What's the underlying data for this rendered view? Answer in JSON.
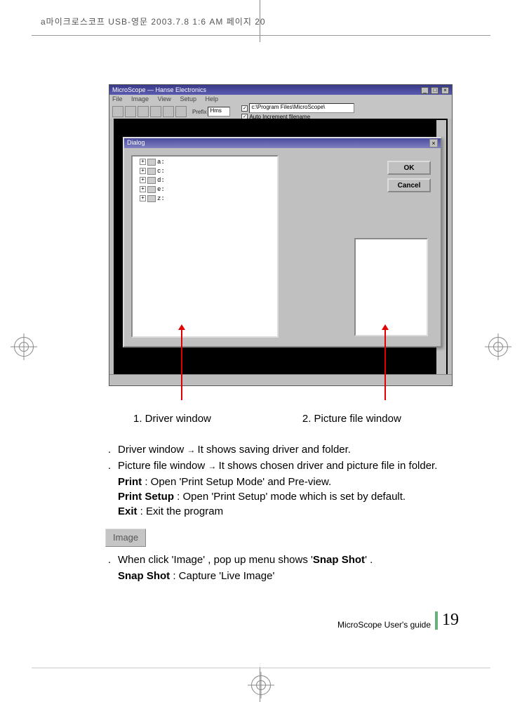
{
  "header_meta": "a마이크로스코프 USB-영문  2003.7.8 1:6 AM  페이지 20",
  "app": {
    "title": "MicroScope  —  Hanse Electronics",
    "menu": {
      "file": "File",
      "image": "Image",
      "view": "View",
      "setup": "Setup",
      "help": "Help"
    },
    "toolbar": {
      "prefix_label": "Prefix",
      "prefix_value": "Hms",
      "path_value": "c:\\Program Files\\MicroScope\\",
      "auto_label": "Auto Increment filename"
    },
    "dialog": {
      "title": "Dialog",
      "drives": [
        "a:",
        "c:",
        "d:",
        "e:",
        "z:"
      ],
      "ok": "OK",
      "cancel": "Cancel"
    }
  },
  "captions": {
    "c1": "1. Driver window",
    "c2": "2. Picture file window"
  },
  "body": {
    "b1_pre": "Driver window ",
    "b1_post": " It shows saving driver and folder.",
    "b2_pre": "Picture file window ",
    "b2_post": " It shows chosen driver and picture file in folder.",
    "print_label": "Print",
    "print_text": " : Open  'Print Setup Mode'  and Pre-view.",
    "psetup_label": "Print Setup",
    "psetup_text": " : Open  'Print Setup'  mode which is set by default.",
    "exit_label": "Exit",
    "exit_text": " : Exit the program",
    "image_badge": "Image",
    "img1_pre": "When click  'Image' , pop up menu shows  '",
    "img1_bold": "Snap Shot",
    "img1_post": "' .",
    "snap_label": "Snap Shot",
    "snap_text": " : Capture  'Live Image'"
  },
  "footer": {
    "label": "MicroScope User's guide",
    "page": "19"
  }
}
